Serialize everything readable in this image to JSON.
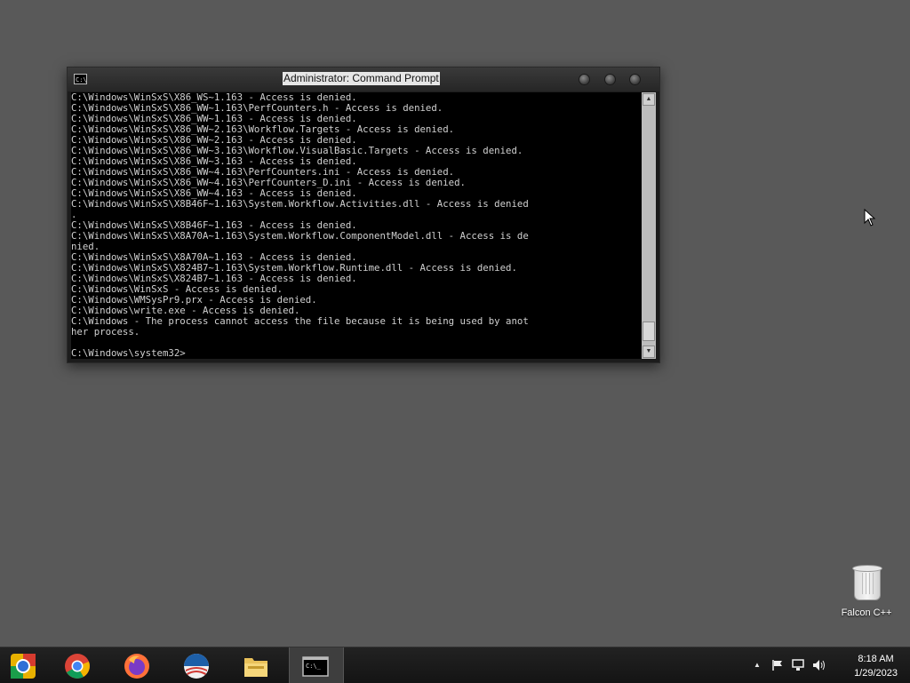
{
  "window": {
    "title": "Administrator: Command Prompt",
    "icon_name": "console-icon",
    "console_lines": [
      "C:\\Windows\\WinSxS\\X86_WS~1.163 - Access is denied.",
      "C:\\Windows\\WinSxS\\X86_WW~1.163\\PerfCounters.h - Access is denied.",
      "C:\\Windows\\WinSxS\\X86_WW~1.163 - Access is denied.",
      "C:\\Windows\\WinSxS\\X86_WW~2.163\\Workflow.Targets - Access is denied.",
      "C:\\Windows\\WinSxS\\X86_WW~2.163 - Access is denied.",
      "C:\\Windows\\WinSxS\\X86_WW~3.163\\Workflow.VisualBasic.Targets - Access is denied.",
      "C:\\Windows\\WinSxS\\X86_WW~3.163 - Access is denied.",
      "C:\\Windows\\WinSxS\\X86_WW~4.163\\PerfCounters.ini - Access is denied.",
      "C:\\Windows\\WinSxS\\X86_WW~4.163\\PerfCounters_D.ini - Access is denied.",
      "C:\\Windows\\WinSxS\\X86_WW~4.163 - Access is denied.",
      "C:\\Windows\\WinSxS\\X8B46F~1.163\\System.Workflow.Activities.dll - Access is denied",
      ".",
      "C:\\Windows\\WinSxS\\X8B46F~1.163 - Access is denied.",
      "C:\\Windows\\WinSxS\\X8A70A~1.163\\System.Workflow.ComponentModel.dll - Access is de",
      "nied.",
      "C:\\Windows\\WinSxS\\X8A70A~1.163 - Access is denied.",
      "C:\\Windows\\WinSxS\\X824B7~1.163\\System.Workflow.Runtime.dll - Access is denied.",
      "C:\\Windows\\WinSxS\\X824B7~1.163 - Access is denied.",
      "C:\\Windows\\WinSxS - Access is denied.",
      "C:\\Windows\\WMSysPr9.prx - Access is denied.",
      "C:\\Windows\\write.exe - Access is denied.",
      "C:\\Windows - The process cannot access the file because it is being used by anot",
      "her process.",
      "",
      "C:\\Windows\\system32>"
    ]
  },
  "desktop": {
    "recycle_bin_label": "Falcon C++",
    "recycle_bin_icon": "recycle-bin-icon"
  },
  "taskbar": {
    "apps": [
      {
        "name": "chrome-canary",
        "icon": "chrome-alt-icon"
      },
      {
        "name": "chrome",
        "icon": "chrome-icon"
      },
      {
        "name": "firefox",
        "icon": "firefox-icon"
      },
      {
        "name": "obama-logo",
        "icon": "circle-logo-icon"
      },
      {
        "name": "file-explorer",
        "icon": "folder-icon"
      },
      {
        "name": "command-prompt",
        "icon": "console-icon",
        "active": true
      }
    ],
    "tray": {
      "show_hidden_icons": "▲",
      "time": "8:18 AM",
      "date": "1/29/2023"
    }
  },
  "colors": {
    "desktop_bg": "#595959",
    "taskbar_bg": "#1b1b1b",
    "console_bg": "#000000",
    "console_text": "#d0d0d0"
  }
}
